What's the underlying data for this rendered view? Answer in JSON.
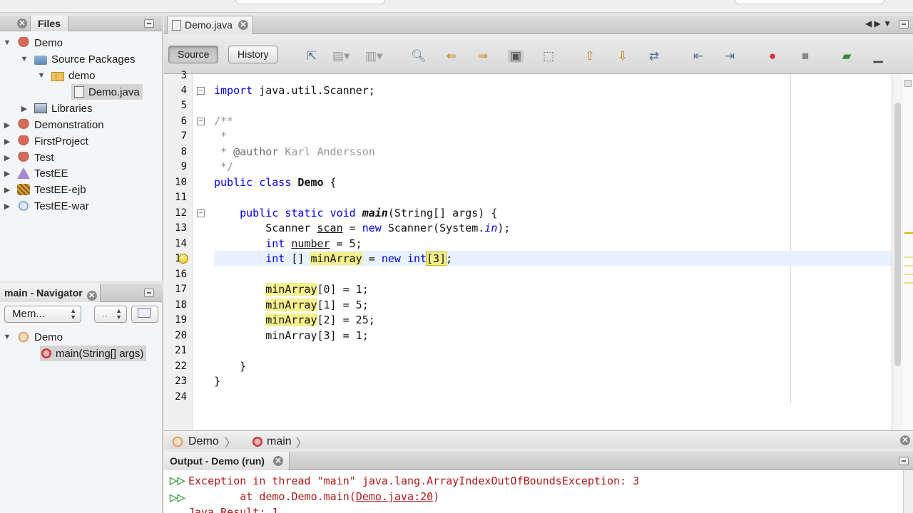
{
  "files_pane": {
    "tab_label": "Files",
    "tree": [
      {
        "label": "Demo",
        "icon": "project-icon"
      },
      {
        "label": "Source Packages",
        "icon": "folder-icon"
      },
      {
        "label": "demo",
        "icon": "package-icon"
      },
      {
        "label": "Demo.java",
        "icon": "java-file-icon"
      },
      {
        "label": "Libraries",
        "icon": "libraries-icon"
      },
      {
        "label": "Demonstration",
        "icon": "project-icon"
      },
      {
        "label": "FirstProject",
        "icon": "project-icon"
      },
      {
        "label": "Test",
        "icon": "project-icon"
      },
      {
        "label": "TestEE",
        "icon": "ee-project-icon"
      },
      {
        "label": "TestEE-ejb",
        "icon": "ejb-project-icon"
      },
      {
        "label": "TestEE-war",
        "icon": "web-project-icon"
      }
    ]
  },
  "navigator": {
    "title": "main - Navigator",
    "members_combo": "Mem...",
    "filter_combo": "..",
    "tree": [
      {
        "label": "Demo",
        "icon": "class-icon"
      },
      {
        "label": "main(String[] args)",
        "icon": "method-icon"
      }
    ]
  },
  "editor": {
    "tab_label": "Demo.java",
    "source_button": "Source",
    "history_button": "History",
    "lines": [
      {
        "n": "3",
        "text": ""
      },
      {
        "n": "4",
        "text": "import java.util.Scanner;"
      },
      {
        "n": "5",
        "text": ""
      },
      {
        "n": "6",
        "text": "/**"
      },
      {
        "n": "7",
        "text": " *"
      },
      {
        "n": "8",
        "text": " * @author Karl Andersson"
      },
      {
        "n": "9",
        "text": " */"
      },
      {
        "n": "10",
        "text": "public class Demo {"
      },
      {
        "n": "11",
        "text": ""
      },
      {
        "n": "12",
        "text": "    public static void main(String[] args) {"
      },
      {
        "n": "13",
        "text": "        Scanner scan = new Scanner(System.in);"
      },
      {
        "n": "14",
        "text": "        int number = 5;"
      },
      {
        "n": "15",
        "text": "        int [] minArray = new int[3];"
      },
      {
        "n": "16",
        "text": ""
      },
      {
        "n": "17",
        "text": "        minArray[0] = 1;"
      },
      {
        "n": "18",
        "text": "        minArray[1] = 5;"
      },
      {
        "n": "19",
        "text": "        minArray[2] = 25;"
      },
      {
        "n": "20",
        "text": "        minArray[3] = 1;"
      },
      {
        "n": "21",
        "text": ""
      },
      {
        "n": "22",
        "text": "    }"
      },
      {
        "n": "23",
        "text": "}"
      },
      {
        "n": "24",
        "text": ""
      }
    ]
  },
  "breadcrumbs": [
    "Demo",
    "main"
  ],
  "output": {
    "tab_label": "Output - Demo (run)",
    "line1": "Exception in thread \"main\" java.lang.ArrayIndexOutOfBoundsException: 3",
    "line2_prefix": "        at demo.Demo.main(",
    "line2_link": "Demo.java:20",
    "line2_suffix": ")",
    "line3": "Java Result: 1"
  },
  "colors": {
    "keyword": "#0000e6",
    "comment": "#969696",
    "error_output": "#b01818",
    "highlight": "#f5f08c"
  }
}
